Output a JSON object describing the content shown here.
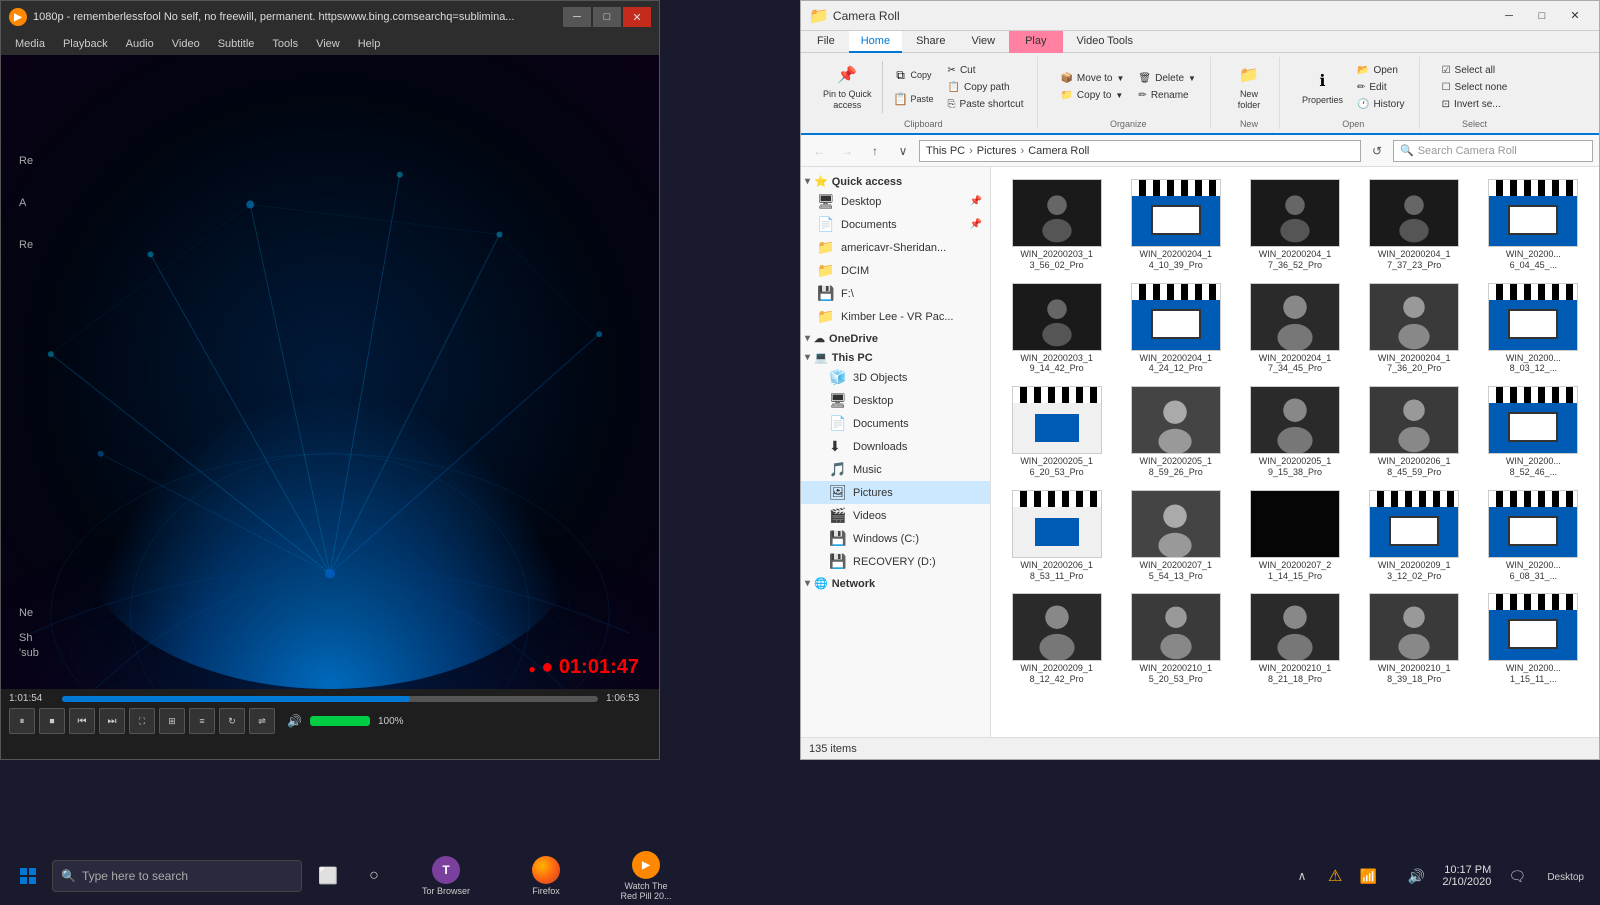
{
  "vlc": {
    "title": "1080p - rememberlessfool No self, no freewill, permanent. httpswww.bing.comsearchq=sublimina...",
    "menus": [
      "Media",
      "Playback",
      "Audio",
      "Video",
      "Subtitle",
      "Tools",
      "View",
      "Help"
    ],
    "time_current": "1:01:54",
    "time_total": "1:06:53",
    "timestamp_overlay": "● 01:01:47",
    "seek_pct": 65,
    "volume_pct": "100%",
    "side_labels": [
      "Re",
      "A",
      "Re",
      "Ne",
      "Sh"
    ],
    "bottom_label": "'sub"
  },
  "explorer": {
    "title": "Camera Roll",
    "tabs": [
      "File",
      "Home",
      "Share",
      "View",
      "Video Tools"
    ],
    "play_tab": "Play",
    "address_path": [
      "This PC",
      "Pictures",
      "Camera Roll"
    ],
    "search_placeholder": "Search Camera Roll",
    "ribbon": {
      "clipboard_group": "Clipboard",
      "organize_group": "Organize",
      "new_group": "New",
      "open_group": "Open",
      "select_group": "Select",
      "pin_label": "Pin to Quick\naccess",
      "copy_label": "Copy",
      "paste_label": "Paste",
      "cut_label": "Cut",
      "copy_path_label": "Copy path",
      "paste_shortcut_label": "Paste shortcut",
      "move_to_label": "Move to",
      "delete_label": "Delete",
      "rename_label": "Rename",
      "copy_to_label": "Copy to",
      "new_folder_label": "New\nfolder",
      "properties_label": "Properties",
      "open_label": "Open",
      "edit_label": "Edit",
      "history_label": "History",
      "select_all_label": "Select all",
      "select_none_label": "Select\nnone",
      "invert_label": "Invert se..."
    },
    "sidebar": {
      "quick_access_label": "Quick access",
      "items": [
        {
          "label": "Desktop",
          "icon": "🖥",
          "pinned": true
        },
        {
          "label": "Documents",
          "icon": "📄",
          "pinned": true
        },
        {
          "label": "americavr-Sheridan...",
          "icon": "📁"
        },
        {
          "label": "DCIM",
          "icon": "📁"
        },
        {
          "label": "F:\\",
          "icon": "💾"
        },
        {
          "label": "Kimber Lee - VR Pac...",
          "icon": "📁"
        }
      ],
      "onedrive_label": "OneDrive",
      "this_pc_label": "This PC",
      "this_pc_items": [
        {
          "label": "3D Objects",
          "icon": "🧊"
        },
        {
          "label": "Desktop",
          "icon": "🖥"
        },
        {
          "label": "Documents",
          "icon": "📄"
        },
        {
          "label": "Downloads",
          "icon": "⬇"
        },
        {
          "label": "Music",
          "icon": "🎵"
        },
        {
          "label": "Pictures",
          "icon": "🖼",
          "active": true
        },
        {
          "label": "Videos",
          "icon": "🎬"
        },
        {
          "label": "Windows (C:)",
          "icon": "💾"
        },
        {
          "label": "RECOVERY (D:)",
          "icon": "💾"
        }
      ],
      "network_label": "Network"
    },
    "files": [
      {
        "name": "WIN_20200203_1\n3_56_02_Pro",
        "type": "video"
      },
      {
        "name": "WIN_20200204_1\n4_10_39_Pro",
        "type": "clapboard"
      },
      {
        "name": "WIN_20200204_1\n7_36_52_Pro",
        "type": "video"
      },
      {
        "name": "WIN_20200204_1\n7_37_23_Pro",
        "type": "video"
      },
      {
        "name": "WIN_20200...\n6_04_45_...",
        "type": "clapboard"
      },
      {
        "name": "WIN_20200203_1\n9_14_42_Pro",
        "type": "video_dark"
      },
      {
        "name": "WIN_20200204_1\n4_24_12_Pro",
        "type": "clapboard"
      },
      {
        "name": "WIN_20200204_1\n7_34_45_Pro",
        "type": "video_person"
      },
      {
        "name": "WIN_20200204_1\n7_36_20_Pro",
        "type": "video_person2"
      },
      {
        "name": "WIN_20200...\n8_03_12_...",
        "type": "clapboard"
      },
      {
        "name": "WIN_20200205_1\n6_20_53_Pro",
        "type": "clapboard_doc"
      },
      {
        "name": "WIN_20200205_1\n8_59_26_Pro",
        "type": "video_person3"
      },
      {
        "name": "WIN_20200205_1\n9_15_38_Pro",
        "type": "video_person"
      },
      {
        "name": "WIN_20200206_1\n8_45_59_Pro",
        "type": "video_person2"
      },
      {
        "name": "WIN_20200...\n8_52_46_...",
        "type": "clapboard"
      },
      {
        "name": "WIN_20200206_1\n8_53_11_Pro",
        "type": "clapboard_doc"
      },
      {
        "name": "WIN_20200207_1\n5_54_13_Pro",
        "type": "video_person3"
      },
      {
        "name": "WIN_20200207_2\n1_14_15_Pro",
        "type": "video_black"
      },
      {
        "name": "WIN_20200209_1\n3_12_02_Pro",
        "type": "clapboard"
      },
      {
        "name": "WIN_20200...\n6_08_31_...",
        "type": "clapboard"
      },
      {
        "name": "WIN_20200209_1\n8_12_42_Pro",
        "type": "video_person"
      },
      {
        "name": "WIN_20200210_1\n5_20_53_Pro",
        "type": "video_person2"
      },
      {
        "name": "WIN_20200210_1\n8_21_18_Pro",
        "type": "video_person"
      },
      {
        "name": "WIN_20200210_1\n8_39_18_Pro",
        "type": "video_person2"
      },
      {
        "name": "WIN_20200...\n1_15_11_...",
        "type": "clapboard"
      }
    ],
    "status": "135 items"
  },
  "taskbar": {
    "search_placeholder": "Type here to search",
    "time": "10:17 PM",
    "date": "2/10/2020",
    "apps": [
      {
        "label": "Tor Browser",
        "icon": "tor"
      },
      {
        "label": "Firefox",
        "icon": "firefox"
      },
      {
        "label": "Watch The\nRed Pill 20...",
        "icon": "vlc"
      }
    ],
    "desktop_label": "Desktop"
  }
}
